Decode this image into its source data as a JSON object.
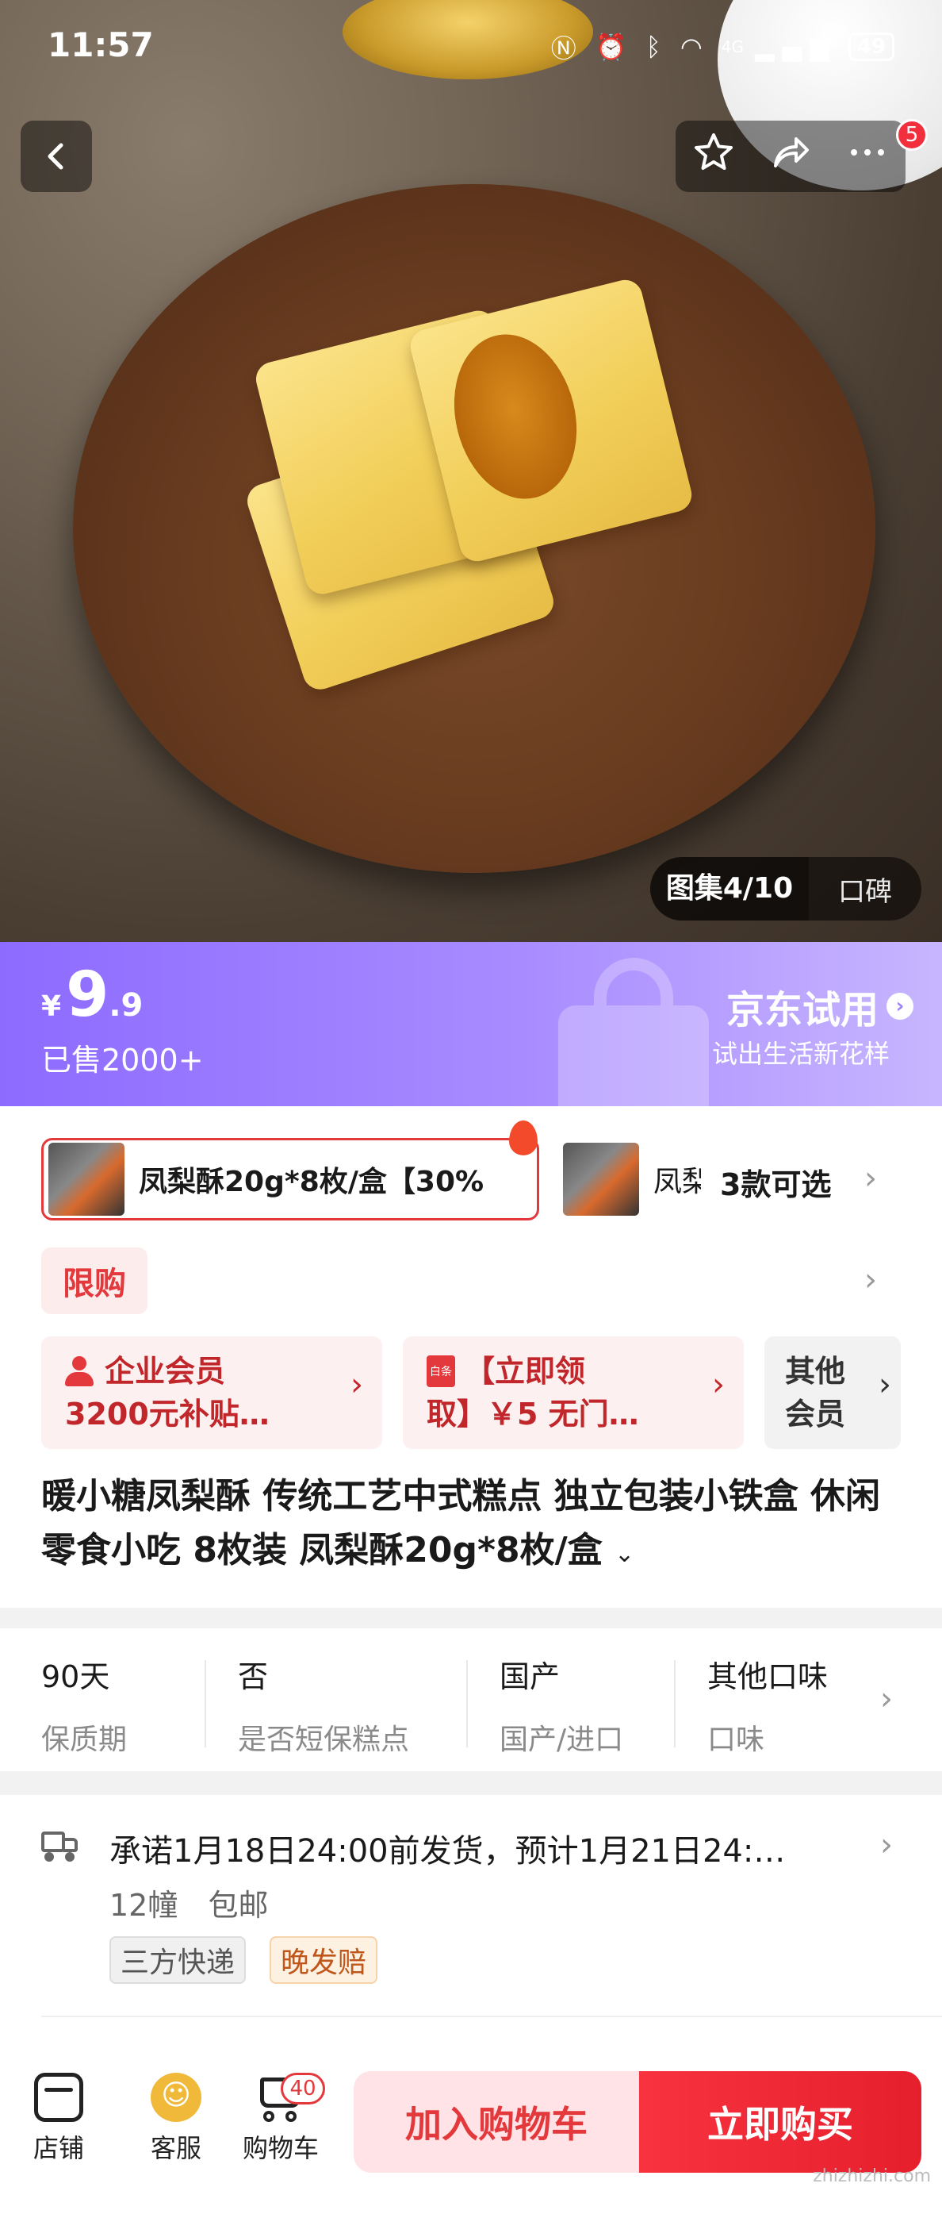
{
  "status_bar": {
    "time": "11:57",
    "battery": "49",
    "network": "4G"
  },
  "header": {
    "badge_count": "5"
  },
  "gallery": {
    "counter": "图集4/10",
    "reviews_label": "口碑"
  },
  "price_banner": {
    "currency": "¥",
    "price_int": "9",
    "price_dec": ".9",
    "sold": "已售2000+",
    "trial_title": "京东试用",
    "trial_subtitle": "试出生活新花样",
    "bg_color": "#9d80ff"
  },
  "variants": {
    "selected_label": "凤梨酥20g*8枚/盒【30%",
    "second_label": "凤梨",
    "more_text": "3款可选"
  },
  "limit_tag": "限购",
  "coupons": [
    {
      "line1": "企业会员",
      "line2": "3200元补贴…"
    },
    {
      "line1": "【立即领",
      "line2": "取】￥5 无门…",
      "icon_text": "白条"
    },
    {
      "line1": "其他",
      "line2": "会员"
    }
  ],
  "product_title": "暖小糖凤梨酥 传统工艺中式糕点 独立包装小铁盒 休闲零食小吃 8枚装 凤梨酥20g*8枚/盒",
  "specs": [
    {
      "value": "90天",
      "key": "保质期"
    },
    {
      "value": "否",
      "key": "是否短保糕点"
    },
    {
      "value": "国产",
      "key": "国产/进口"
    },
    {
      "value": "其他口味",
      "key": "口味"
    }
  ],
  "delivery": {
    "promise": "承诺1月18日24:00前发货，预计1月21日24:…",
    "location": "12幢",
    "shipping": "包邮",
    "tags": [
      "三方快递",
      "晚发赔"
    ]
  },
  "bottom_bar": {
    "store_label": "店铺",
    "service_label": "客服",
    "cart_label": "购物车",
    "cart_count": "40",
    "add_to_cart": "加入购物车",
    "buy_now": "立即购买"
  },
  "watermark": "zhizhizhi.com",
  "colors": {
    "accent_red": "#e4393c",
    "buy_red": "#f8323e",
    "purple": "#9d80ff"
  }
}
